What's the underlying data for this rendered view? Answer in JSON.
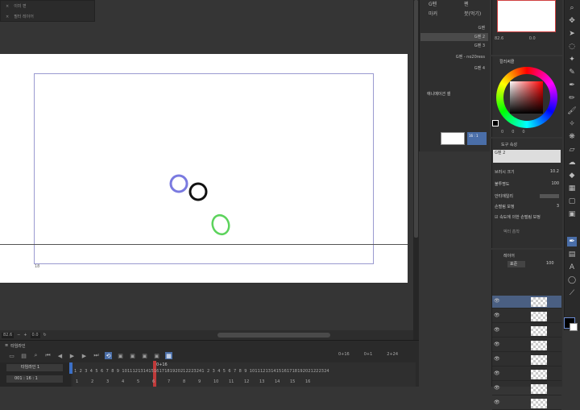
{
  "tl_panel": {
    "rows": [
      "이미 편",
      "필터 레이어"
    ]
  },
  "canvas": {
    "frame_number": "18",
    "zoom": "82.6",
    "angle": "0.0"
  },
  "timeline": {
    "tabs": [
      "타임라인"
    ],
    "track_select": "타임라인 1",
    "track_label": "001 : 16 : 1",
    "counters": [
      "0+16",
      "0+1",
      "2+24"
    ],
    "playhead_label": "0+16",
    "ruler_top": [
      "1",
      "2",
      "3",
      "4",
      "5",
      "6",
      "7",
      "8",
      "9",
      "10",
      "11",
      "12",
      "13",
      "14",
      "15",
      "16",
      "17",
      "18",
      "19",
      "20",
      "21",
      "22",
      "23",
      "24",
      "1",
      "2",
      "3",
      "4",
      "5",
      "6",
      "7",
      "8",
      "9",
      "10",
      "11",
      "12",
      "13",
      "14",
      "15",
      "16",
      "17",
      "18",
      "19",
      "20",
      "21",
      "22",
      "23",
      "24"
    ],
    "ruler_bottom": [
      "1",
      "2",
      "3",
      "4",
      "5",
      "6",
      "7",
      "8",
      "9",
      "10",
      "11",
      "12",
      "13",
      "14",
      "15",
      "16"
    ]
  },
  "brushes": {
    "tab_a": "G펜",
    "tab_b": "펜",
    "tab_c": "마커",
    "tab_d": "붓(먹기)",
    "items": [
      "G펜",
      "G펜 2",
      "G펜 3",
      "G펜 - no20ress",
      "G펜 4"
    ],
    "selected_index": 1
  },
  "navigator": {
    "zoom": "82.6",
    "angle": "0.0"
  },
  "color": {
    "title": "컬러써클",
    "values": [
      "0",
      "0",
      "0"
    ]
  },
  "animation_cels": {
    "title": "애니메이션 셀",
    "cel_value": "16 : 1"
  },
  "tool_property": {
    "title": "도구 속성",
    "preview_label": "G펜 2",
    "rows": [
      {
        "label": "브러시 크기",
        "value": "10.2"
      },
      {
        "label": "불투명도",
        "value": "100"
      },
      {
        "label": "안티에일리",
        "value": ""
      },
      {
        "label": "손떨림 보정",
        "value": "3"
      }
    ],
    "check_label": "속도에 의한 손떨림 보정",
    "extra": "벡터 흡착"
  },
  "layers": {
    "title": "레이어",
    "blend": "표준",
    "opacity": "100",
    "rows": 8,
    "selected": 0
  },
  "colors": {
    "accent": "#4a6ea8",
    "playhead": "#c03a3a",
    "frame": "#9a9ad0"
  }
}
